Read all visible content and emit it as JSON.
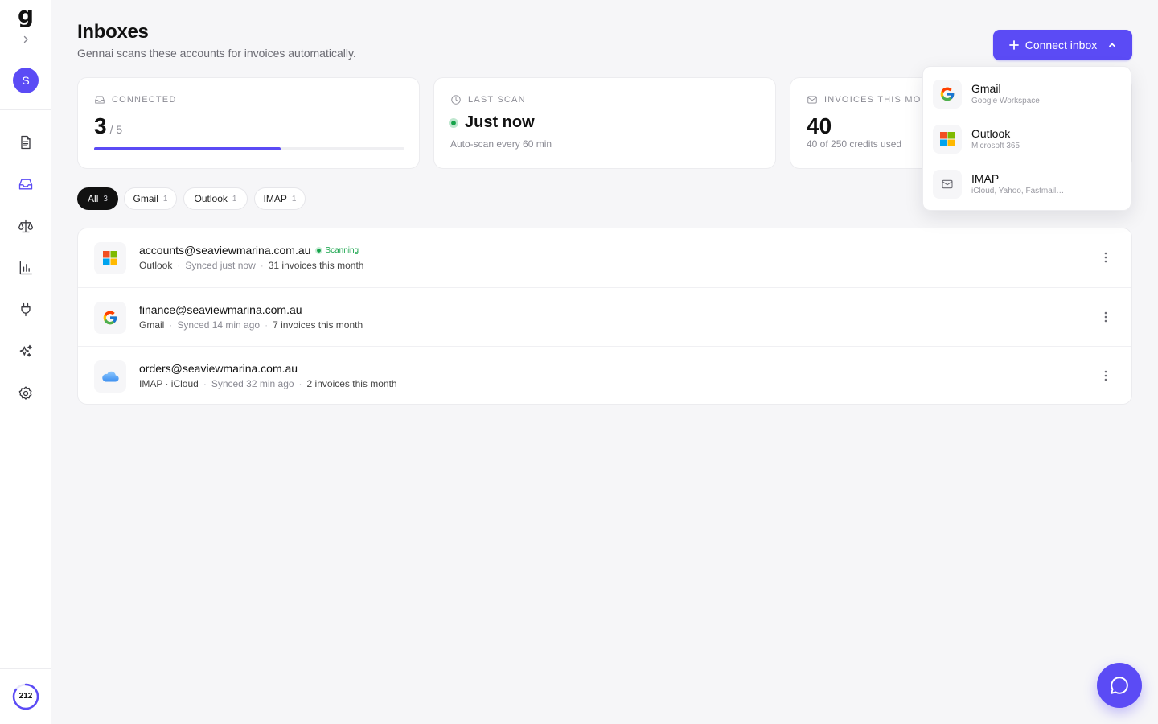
{
  "app": {
    "logo": "g",
    "avatar_initial": "S",
    "credits": "212",
    "credits_fraction": 0.85
  },
  "nav": [
    {
      "name": "documents",
      "icon": "document-icon",
      "active": false
    },
    {
      "name": "inboxes",
      "icon": "inbox-icon",
      "active": true
    },
    {
      "name": "reconcile",
      "icon": "scale-icon",
      "active": false
    },
    {
      "name": "reports",
      "icon": "bar-chart-icon",
      "active": false
    },
    {
      "name": "integrations",
      "icon": "plug-icon",
      "active": false
    },
    {
      "name": "ai",
      "icon": "sparkles-icon",
      "active": false
    },
    {
      "name": "settings",
      "icon": "gear-icon",
      "active": false
    }
  ],
  "header": {
    "title": "Inboxes",
    "subtitle": "Gennai scans these accounts for invoices automatically.",
    "connect_label": "Connect inbox"
  },
  "stats": {
    "connected": {
      "label": "CONNECTED",
      "value": "3",
      "of": "/ 5",
      "progress": 0.6
    },
    "last_scan": {
      "label": "LAST SCAN",
      "value": "Just now",
      "sub": "Auto-scan every 60 min"
    },
    "invoices": {
      "label": "INVOICES THIS MONTH",
      "value": "40",
      "sub": "40 of 250 credits used"
    }
  },
  "filters": [
    {
      "label": "All",
      "count": "3",
      "active": true
    },
    {
      "label": "Gmail",
      "count": "1",
      "active": false
    },
    {
      "label": "Outlook",
      "count": "1",
      "active": false
    },
    {
      "label": "IMAP",
      "count": "1",
      "active": false
    }
  ],
  "inboxes": [
    {
      "email": "accounts@seaviewmarina.com.au",
      "provider": "Outlook",
      "synced": "Synced just now",
      "invoices": "31 invoices this month",
      "badge": "Scanning",
      "icon": "microsoft-icon"
    },
    {
      "email": "finance@seaviewmarina.com.au",
      "provider": "Gmail",
      "synced": "Synced 14 min ago",
      "invoices": "7 invoices this month",
      "badge": "",
      "icon": "google-icon"
    },
    {
      "email": "orders@seaviewmarina.com.au",
      "provider": "IMAP · iCloud",
      "synced": "Synced 32 min ago",
      "invoices": "2 invoices this month",
      "badge": "",
      "icon": "icloud-icon"
    }
  ],
  "dropdown": [
    {
      "title": "Gmail",
      "sub": "Google Workspace",
      "icon": "google-icon"
    },
    {
      "title": "Outlook",
      "sub": "Microsoft 365",
      "icon": "microsoft-icon"
    },
    {
      "title": "IMAP",
      "sub": "iCloud, Yahoo, Fastmail…",
      "icon": "mail-icon"
    }
  ],
  "colors": {
    "accent": "#5b4bf5",
    "success": "#16a34a"
  }
}
